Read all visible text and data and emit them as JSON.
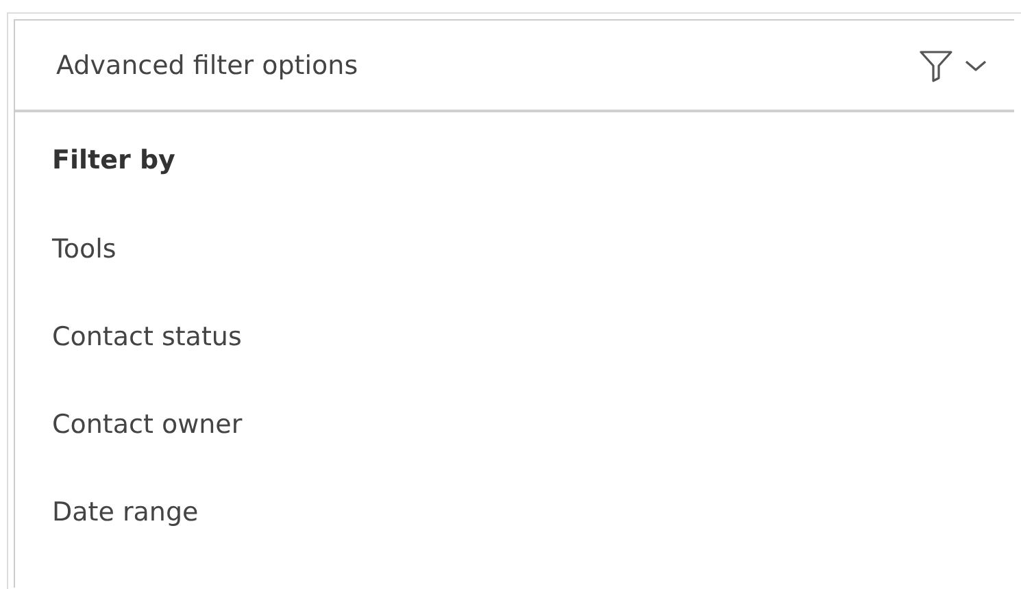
{
  "panel": {
    "title": "Advanced filter options",
    "expanded": true,
    "heading": "Filter by",
    "options": [
      {
        "label": "Tools"
      },
      {
        "label": "Contact status"
      },
      {
        "label": "Contact owner"
      },
      {
        "label": "Date range"
      }
    ]
  }
}
